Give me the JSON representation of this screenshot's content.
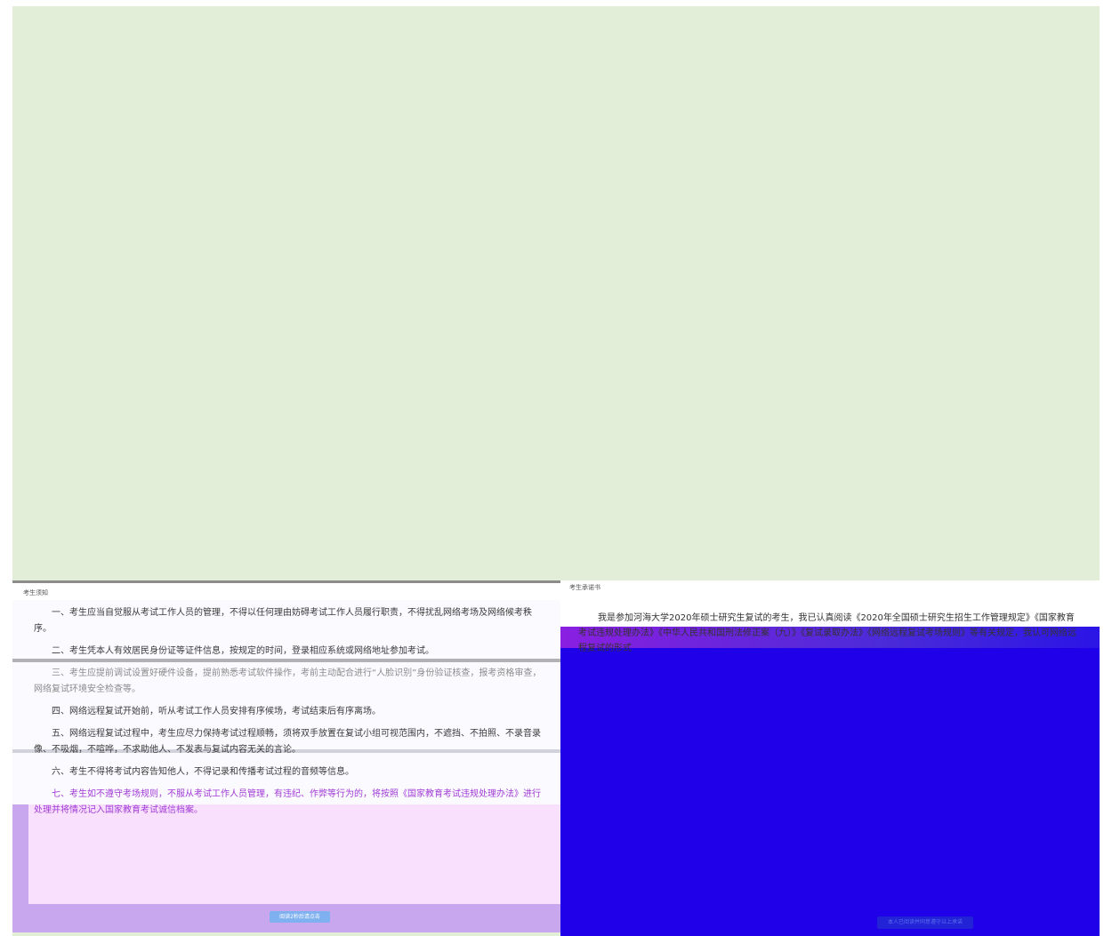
{
  "notice": {
    "title": "考生须知",
    "items": [
      "一、考生应当自觉服从考试工作人员的管理，不得以任何理由妨碍考试工作人员履行职责，不得扰乱网络考场及网络候考秩序。",
      "二、考生凭本人有效居民身份证等证件信息，按规定的时间，登录相应系统或网络地址参加考试。",
      "三、考生应提前调试设置好硬件设备，提前熟悉考试软件操作，考前主动配合进行“人脸识别”身份验证核查，报考资格审查，网络复试环境安全检查等。",
      "四、网络远程复试开始前，听从考试工作人员安排有序候场，考试结束后有序离场。",
      "五、网络远程复试过程中，考生应尽力保持考试过程顺畅，须将双手放置在复试小组可视范围内，不遮挡、不拍照、不录音录像、不吸烟，不喧哗，不求助他人、不发表与复试内容无关的言论。",
      "六、考生不得将考试内容告知他人，不得记录和传播考试过程的音频等信息。",
      "七、考生如不遵守考场规则，不服从考试工作人员管理，有违纪、作弊等行为的，将按照《国家教育考试违规处理办法》进行处理并将情况记入国家教育考试诚信档案。"
    ],
    "button_label": "阅读2秒后请点击"
  },
  "pledge": {
    "title": "考生承诺书",
    "body": "我是参加河海大学2020年硕士研究生复试的考生，我已认真阅读《2020年全国硕士研究生招生工作管理规定》《国家教育考试违规处理办法》《中华人民共和国刑法修正案（九）》《复试录取办法》《网络远程复试考场规则》等有关规定，我认可网络远程复试的形式",
    "button_label": "本人已阅读并同意遵守以上承诺"
  },
  "colors": {
    "background": "#e2eed8",
    "notice_base": "#c9a7ef",
    "pledge_base": "#1f00e8",
    "accent_button": "#7fb0f0"
  }
}
